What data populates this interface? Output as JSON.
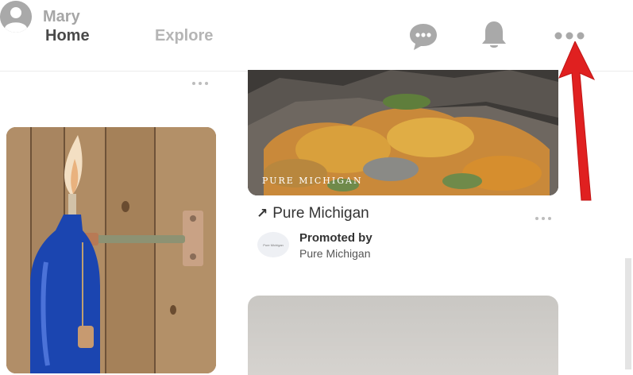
{
  "nav": {
    "home_label": "Home",
    "explore_label": "Explore",
    "profile_label": "Mary",
    "icons": [
      "messages-icon",
      "notifications-bell-icon",
      "more-options-icon"
    ]
  },
  "pins": [
    {
      "image_watermark": "PURE MICHIGAN",
      "title": "Pure Michigan",
      "promoted_heading": "Promoted by",
      "promoter": "Pure Michigan",
      "promoter_logo_text": "Pure Michigan"
    }
  ],
  "annotation": {
    "arrow_color": "#e02020"
  }
}
